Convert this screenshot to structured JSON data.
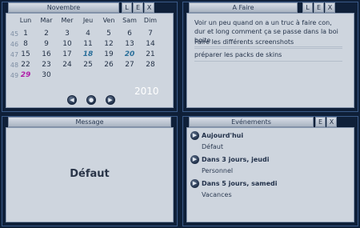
{
  "calendar": {
    "title": "Novembre",
    "year": "2010",
    "days": [
      "Lun",
      "Mar",
      "Mer",
      "Jeu",
      "Ven",
      "Sam",
      "Dim"
    ],
    "weeks": [
      {
        "num": "45",
        "dates": [
          "1",
          "2",
          "3",
          "4",
          "5",
          "6",
          "7"
        ]
      },
      {
        "num": "46",
        "dates": [
          "8",
          "9",
          "10",
          "11",
          "12",
          "13",
          "14"
        ]
      },
      {
        "num": "47",
        "dates": [
          "15",
          "16",
          "17",
          "18",
          "19",
          "20",
          "21"
        ]
      },
      {
        "num": "48",
        "dates": [
          "22",
          "23",
          "24",
          "25",
          "26",
          "27",
          "28"
        ]
      },
      {
        "num": "49",
        "dates": [
          "29",
          "30",
          "",
          "",
          "",
          "",
          ""
        ]
      }
    ],
    "highlight_blue": [
      "18",
      "20"
    ],
    "highlight_purple": [
      "29"
    ]
  },
  "todo": {
    "title": "A Faire",
    "items": [
      "Voir un peu quand on a un truc à faire con, dur et long comment ça se passe dans la boi boite",
      "Faire les différents screenshots",
      "préparer les packs de skins"
    ]
  },
  "message": {
    "title": "Message",
    "body": "Défaut"
  },
  "events": {
    "title": "Evénements",
    "items": [
      {
        "title": "Aujourd'hui",
        "sub": "Défaut"
      },
      {
        "title": "Dans 3 jours, jeudi",
        "sub": "Personnel"
      },
      {
        "title": "Dans 5 jours, samedi",
        "sub": "Vacances"
      }
    ]
  },
  "window_controls": {
    "minimize": "L",
    "maximize": "E",
    "close": "X"
  },
  "colors": {
    "accent_blue": "#2a6f9a",
    "accent_purple": "#b01ea8"
  }
}
